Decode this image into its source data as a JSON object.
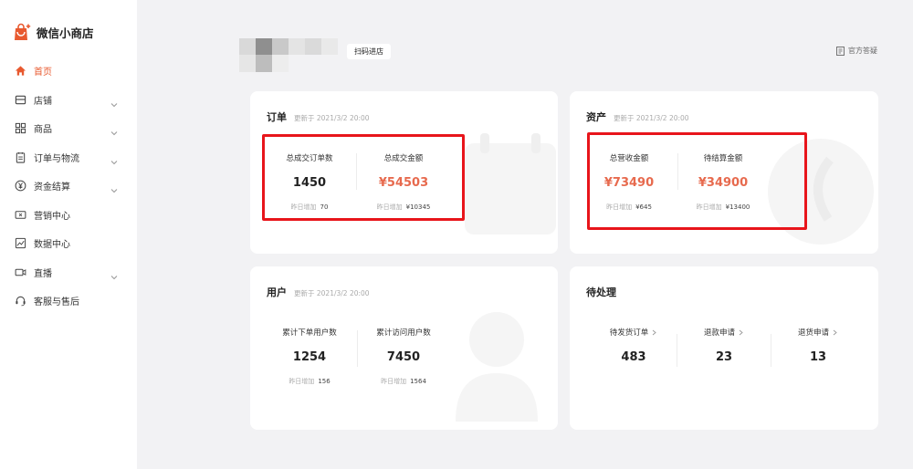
{
  "brand": {
    "name": "微信小商店"
  },
  "sidebar": {
    "items": [
      {
        "label": "首页",
        "icon": "home-icon",
        "active": true,
        "expandable": false
      },
      {
        "label": "店铺",
        "icon": "store-icon",
        "active": false,
        "expandable": true
      },
      {
        "label": "商品",
        "icon": "grid-icon",
        "active": false,
        "expandable": true
      },
      {
        "label": "订单与物流",
        "icon": "clipboard-icon",
        "active": false,
        "expandable": true
      },
      {
        "label": "资金结算",
        "icon": "yuan-icon",
        "active": false,
        "expandable": true
      },
      {
        "label": "营销中心",
        "icon": "coupon-icon",
        "active": false,
        "expandable": false
      },
      {
        "label": "数据中心",
        "icon": "chart-icon",
        "active": false,
        "expandable": false
      },
      {
        "label": "直播",
        "icon": "video-icon",
        "active": false,
        "expandable": true
      },
      {
        "label": "客服与售后",
        "icon": "headset-icon",
        "active": false,
        "expandable": false
      }
    ]
  },
  "header": {
    "scan_label": "扫码进店",
    "help_label": "官方答疑"
  },
  "orders": {
    "title": "订单",
    "updated": "更新于 2021/3/2  20:00",
    "metrics": [
      {
        "label": "总成交订单数",
        "value": "1450",
        "foot_label": "昨日增加",
        "foot_value": "70"
      },
      {
        "label": "总成交金额",
        "value": "¥54503",
        "foot_label": "昨日增加",
        "foot_value": "¥10345"
      }
    ]
  },
  "assets": {
    "title": "资产",
    "updated": "更新于 2021/3/2  20:00",
    "metrics": [
      {
        "label": "总营收金额",
        "value": "¥73490",
        "foot_label": "昨日增加",
        "foot_value": "¥645"
      },
      {
        "label": "待结算金额",
        "value": "¥34900",
        "foot_label": "昨日增加",
        "foot_value": "¥13400"
      }
    ]
  },
  "users": {
    "title": "用户",
    "updated": "更新于 2021/3/2  20:00",
    "metrics": [
      {
        "label": "累计下单用户数",
        "value": "1254",
        "foot_label": "昨日增加",
        "foot_value": "156"
      },
      {
        "label": "累计访问用户数",
        "value": "7450",
        "foot_label": "昨日增加",
        "foot_value": "1564"
      }
    ]
  },
  "pending": {
    "title": "待处理",
    "items": [
      {
        "label": "待发货订单",
        "value": "483"
      },
      {
        "label": "退款申请",
        "value": "23"
      },
      {
        "label": "退货申请",
        "value": "13"
      }
    ]
  },
  "colors": {
    "accent": "#e8592f",
    "money": "#e76a4e",
    "highlight": "#e8151b"
  }
}
